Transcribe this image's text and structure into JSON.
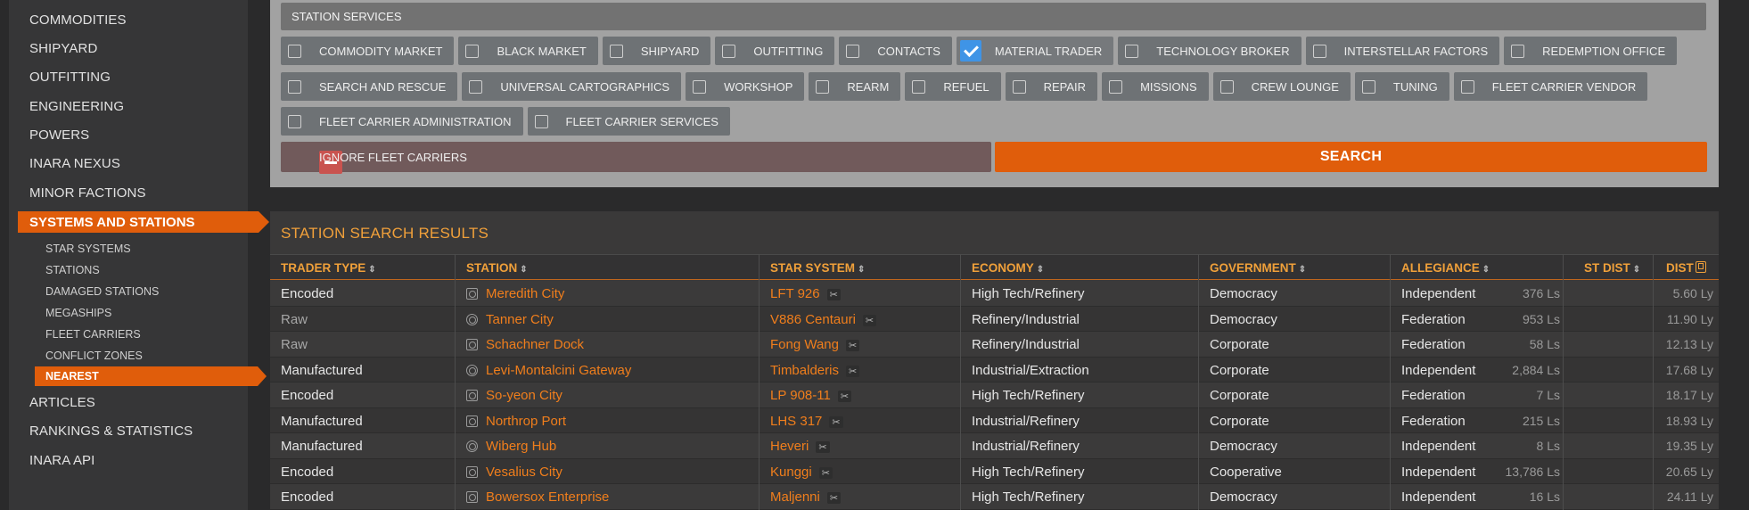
{
  "sidebar": {
    "items": [
      {
        "label": "COMMODITIES"
      },
      {
        "label": "SHIPYARD"
      },
      {
        "label": "OUTFITTING"
      },
      {
        "label": "ENGINEERING"
      },
      {
        "label": "POWERS"
      },
      {
        "label": "INARA NEXUS"
      },
      {
        "label": "MINOR FACTIONS"
      },
      {
        "label": "SYSTEMS AND STATIONS",
        "active": true
      },
      {
        "label": "ARTICLES"
      },
      {
        "label": "RANKINGS & STATISTICS"
      },
      {
        "label": "INARA API"
      }
    ],
    "subitems": [
      {
        "label": "STAR SYSTEMS"
      },
      {
        "label": "STATIONS"
      },
      {
        "label": "DAMAGED STATIONS"
      },
      {
        "label": "MEGASHIPS"
      },
      {
        "label": "FLEET CARRIERS"
      },
      {
        "label": "CONFLICT ZONES"
      },
      {
        "label": "NEAREST",
        "active": true
      }
    ]
  },
  "services": {
    "title": "STATION SERVICES",
    "rows": [
      [
        {
          "label": "COMMODITY MARKET",
          "checked": false
        },
        {
          "label": "BLACK MARKET",
          "checked": false
        },
        {
          "label": "SHIPYARD",
          "checked": false
        },
        {
          "label": "OUTFITTING",
          "checked": false
        },
        {
          "label": "CONTACTS",
          "checked": false
        },
        {
          "label": "MATERIAL TRADER",
          "checked": true
        },
        {
          "label": "TECHNOLOGY BROKER",
          "checked": false
        },
        {
          "label": "INTERSTELLAR FACTORS",
          "checked": false
        },
        {
          "label": "REDEMPTION OFFICE",
          "checked": false
        }
      ],
      [
        {
          "label": "SEARCH AND RESCUE",
          "checked": false
        },
        {
          "label": "UNIVERSAL CARTOGRAPHICS",
          "checked": false
        },
        {
          "label": "WORKSHOP",
          "checked": false
        },
        {
          "label": "REARM",
          "checked": false
        },
        {
          "label": "REFUEL",
          "checked": false
        },
        {
          "label": "REPAIR",
          "checked": false
        },
        {
          "label": "MISSIONS",
          "checked": false
        },
        {
          "label": "CREW LOUNGE",
          "checked": false
        },
        {
          "label": "TUNING",
          "checked": false
        },
        {
          "label": "FLEET CARRIER VENDOR",
          "checked": false
        }
      ],
      [
        {
          "label": "FLEET CARRIER ADMINISTRATION",
          "checked": false
        },
        {
          "label": "FLEET CARRIER SERVICES",
          "checked": false
        }
      ]
    ],
    "ignore_label": "IGNORE FLEET CARRIERS",
    "search_label": "SEARCH"
  },
  "results": {
    "title": "STATION SEARCH RESULTS",
    "columns": [
      "TRADER TYPE",
      "STATION",
      "STAR SYSTEM",
      "ECONOMY",
      "GOVERNMENT",
      "ALLEGIANCE",
      "ST DIST",
      "DIST"
    ],
    "sort_glyph": "⇕",
    "tool_glyph": "✂",
    "rows": [
      {
        "trader": "Encoded",
        "station": "Meredith City",
        "station_icon": "outpost",
        "system": "LFT 926",
        "economy": "High Tech/Refinery",
        "government": "Democracy",
        "allegiance": "Independent",
        "st_dist": "376 Ls",
        "dist": "5.60 Ly"
      },
      {
        "trader": "Raw",
        "station": "Tanner City",
        "station_icon": "coriolis",
        "system": "V886 Centauri",
        "economy": "Refinery/Industrial",
        "government": "Democracy",
        "allegiance": "Federation",
        "st_dist": "953 Ls",
        "dist": "11.90 Ly"
      },
      {
        "trader": "Raw",
        "station": "Schachner Dock",
        "station_icon": "outpost",
        "system": "Fong Wang",
        "economy": "Refinery/Industrial",
        "government": "Corporate",
        "allegiance": "Federation",
        "st_dist": "58 Ls",
        "dist": "12.13 Ly"
      },
      {
        "trader": "Manufactured",
        "station": "Levi-Montalcini Gateway",
        "station_icon": "coriolis",
        "system": "Timbalderis",
        "economy": "Industrial/Extraction",
        "government": "Corporate",
        "allegiance": "Independent",
        "st_dist": "2,884 Ls",
        "dist": "17.68 Ly"
      },
      {
        "trader": "Encoded",
        "station": "So-yeon City",
        "station_icon": "outpost",
        "system": "LP 908-11",
        "economy": "High Tech/Refinery",
        "government": "Corporate",
        "allegiance": "Federation",
        "st_dist": "7 Ls",
        "dist": "18.17 Ly"
      },
      {
        "trader": "Manufactured",
        "station": "Northrop Port",
        "station_icon": "outpost",
        "system": "LHS 317",
        "economy": "Industrial/Refinery",
        "government": "Corporate",
        "allegiance": "Federation",
        "st_dist": "215 Ls",
        "dist": "18.93 Ly"
      },
      {
        "trader": "Manufactured",
        "station": "Wiberg Hub",
        "station_icon": "coriolis",
        "system": "Heveri",
        "economy": "Industrial/Refinery",
        "government": "Democracy",
        "allegiance": "Independent",
        "st_dist": "8 Ls",
        "dist": "19.35 Ly"
      },
      {
        "trader": "Encoded",
        "station": "Vesalius City",
        "station_icon": "outpost",
        "system": "Kunggi",
        "economy": "High Tech/Refinery",
        "government": "Cooperative",
        "allegiance": "Independent",
        "st_dist": "13,786 Ls",
        "dist": "20.65 Ly"
      },
      {
        "trader": "Encoded",
        "station": "Bowersox Enterprise",
        "station_icon": "outpost",
        "system": "Maljenni",
        "economy": "High Tech/Refinery",
        "government": "Democracy",
        "allegiance": "Independent",
        "st_dist": "16 Ls",
        "dist": "24.11 Ly"
      }
    ]
  }
}
